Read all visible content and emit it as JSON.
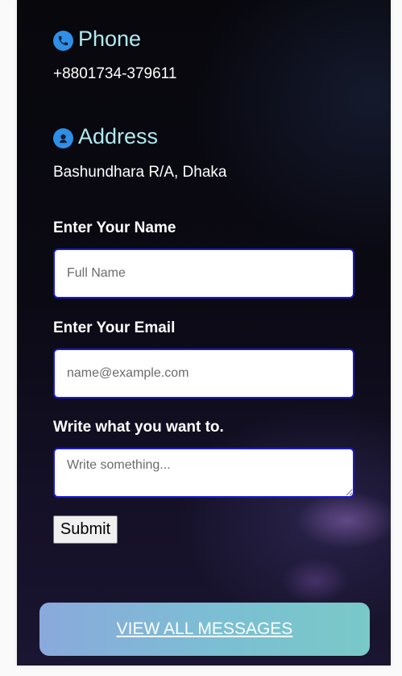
{
  "contact": {
    "phone": {
      "heading": "Phone",
      "icon": "phone-icon",
      "value": "+8801734-379611"
    },
    "address": {
      "heading": "Address",
      "icon": "location-pin-icon",
      "value": "Bashundhara R/A, Dhaka"
    }
  },
  "form": {
    "name": {
      "label": "Enter Your Name",
      "placeholder": "Full Name",
      "value": ""
    },
    "email": {
      "label": "Enter Your Email",
      "placeholder": "name@example.com",
      "value": ""
    },
    "message": {
      "label": "Write what you want to.",
      "placeholder": "Write something...",
      "value": ""
    },
    "submit_label": "Submit"
  },
  "view_all_label": "VIEW ALL MESSAGES",
  "colors": {
    "heading": "#aeeaf0",
    "icon_bg": "#2f8fe6",
    "input_border": "#1a1ad6",
    "button_gradient_start": "#8aa9dc",
    "button_gradient_end": "#79c9c8"
  }
}
